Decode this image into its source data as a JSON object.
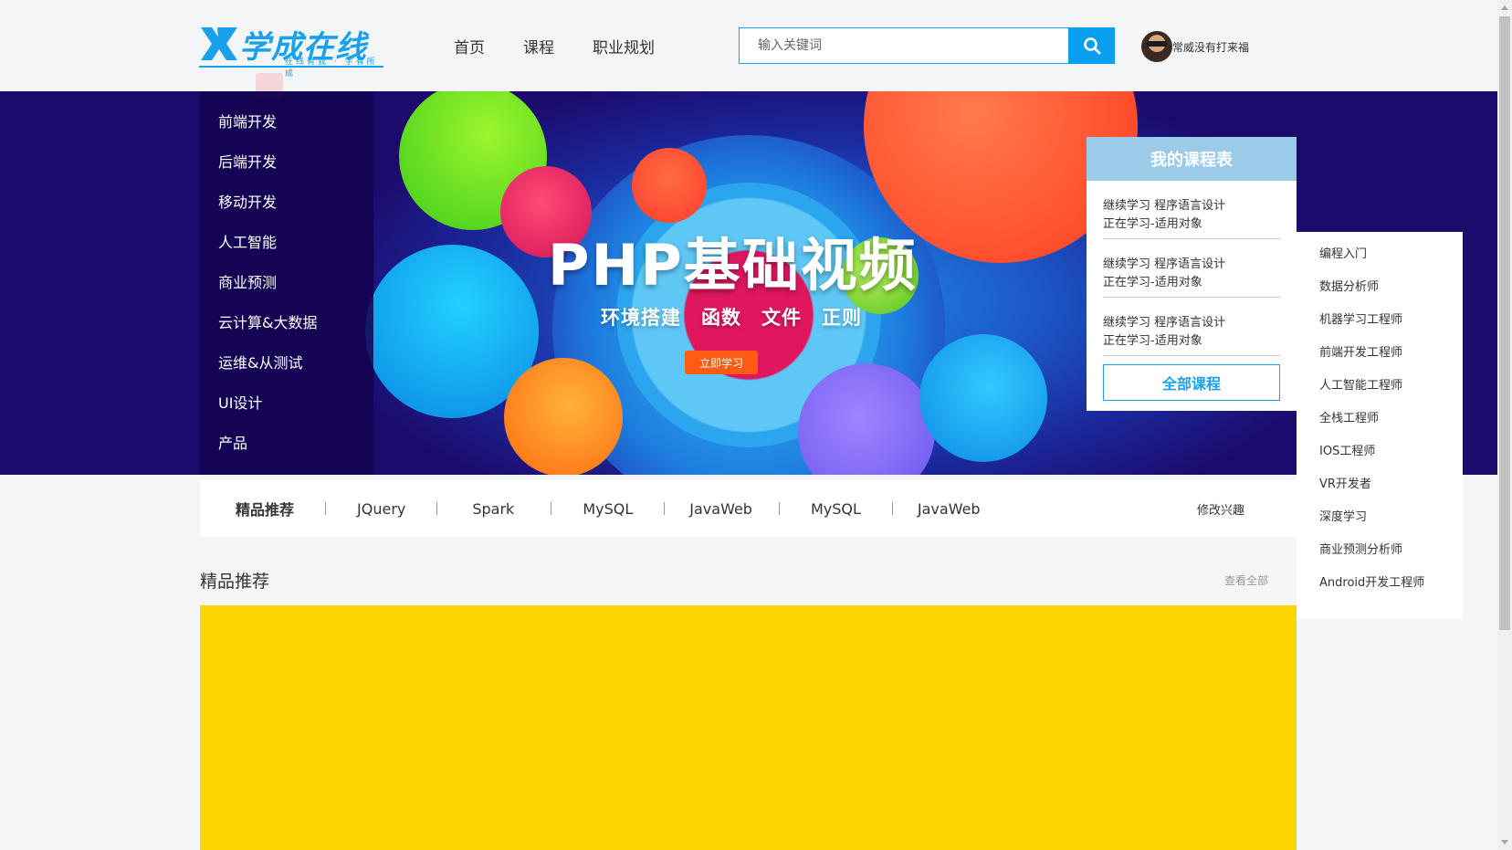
{
  "header": {
    "logo_text": "学成在线",
    "logo_slogan": "在线有我 · 学有所成",
    "nav": [
      "首页",
      "课程",
      "职业规划"
    ],
    "search_placeholder": "输入关键词",
    "user_name": "常威没有打来福"
  },
  "categories": [
    "前端开发",
    "后端开发",
    "移动开发",
    "人工智能",
    "商业预测",
    "云计算&大数据",
    "运维&从测试",
    "UI设计",
    "产品"
  ],
  "banner": {
    "title": "PHP基础视频",
    "subtitle": "环境搭建　函数　文件　正则",
    "button": "立即学习"
  },
  "my_courses": {
    "title": "我的课程表",
    "entries": [
      {
        "line1": "继续学习 程序语言设计",
        "line2": "正在学习-适用对象"
      },
      {
        "line1": "继续学习 程序语言设计",
        "line2": "正在学习-适用对象"
      },
      {
        "line1": "继续学习 程序语言设计",
        "line2": "正在学习-适用对象"
      }
    ],
    "all_button": "全部课程"
  },
  "careers": [
    "编程入门",
    "数据分析师",
    "机器学习工程师",
    "前端开发工程师",
    "人工智能工程师",
    "全栈工程师",
    "IOS工程师",
    "VR开发者",
    "深度学习",
    "商业预测分析师",
    "Android开发工程师"
  ],
  "tags": [
    "精品推荐",
    "JQuery",
    "Spark",
    "MySQL",
    "JavaWeb",
    "MySQL",
    "JavaWeb"
  ],
  "modify_interest": "修改兴趣",
  "section": {
    "title": "精品推荐",
    "view_all": "查看全部"
  },
  "colors": {
    "primary": "#1aa1ec",
    "banner_bg": "#1c0b6d",
    "course_head": "#9ccbe9",
    "button_orange": "#ff5b14",
    "block_yellow": "#fed500"
  }
}
